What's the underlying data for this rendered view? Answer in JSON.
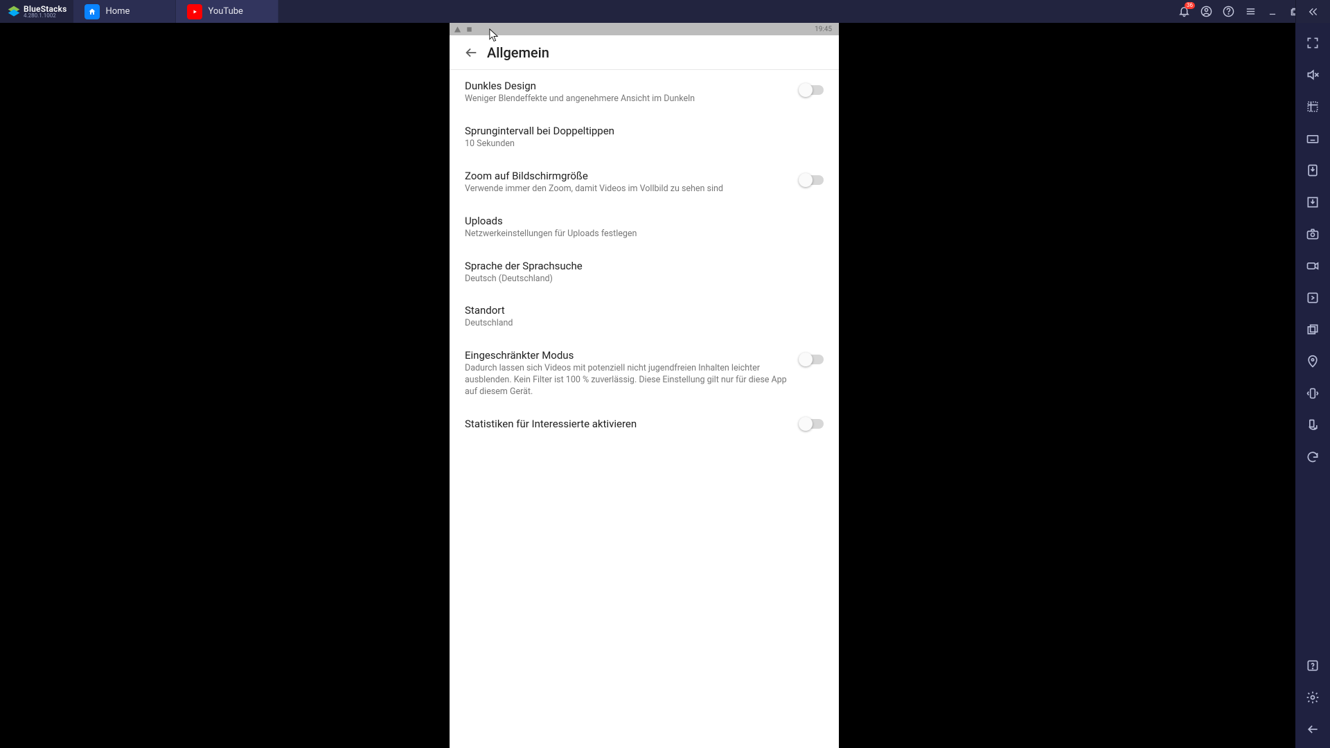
{
  "bluestacks": {
    "name": "BlueStacks",
    "version": "4.280.1.1002",
    "notification_count": "36",
    "tabs": {
      "home": "Home",
      "youtube": "YouTube"
    }
  },
  "statusbar": {
    "time": "19:45"
  },
  "appbar": {
    "title": "Allgemein"
  },
  "settings": {
    "dark": {
      "title": "Dunkles Design",
      "sub": "Weniger Blendeffekte und angenehmere Ansicht im Dunkeln"
    },
    "doubletap": {
      "title": "Sprungintervall bei Doppeltippen",
      "sub": "10 Sekunden"
    },
    "zoom": {
      "title": "Zoom auf Bildschirmgröße",
      "sub": "Verwende immer den Zoom, damit Videos im Vollbild zu sehen sind"
    },
    "uploads": {
      "title": "Uploads",
      "sub": "Netzwerkeinstellungen für Uploads festlegen"
    },
    "voice": {
      "title": "Sprache der Sprachsuche",
      "sub": "Deutsch (Deutschland)"
    },
    "location": {
      "title": "Standort",
      "sub": "Deutschland"
    },
    "restricted": {
      "title": "Eingeschränkter Modus",
      "sub": "Dadurch lassen sich Videos mit potenziell nicht jugendfreien Inhalten leichter ausblenden. Kein Filter ist 100 % zuverlässig. Diese Einstellung gilt nur für diese App auf diesem Gerät."
    },
    "stats": {
      "title": "Statistiken für Interessierte aktivieren"
    }
  }
}
